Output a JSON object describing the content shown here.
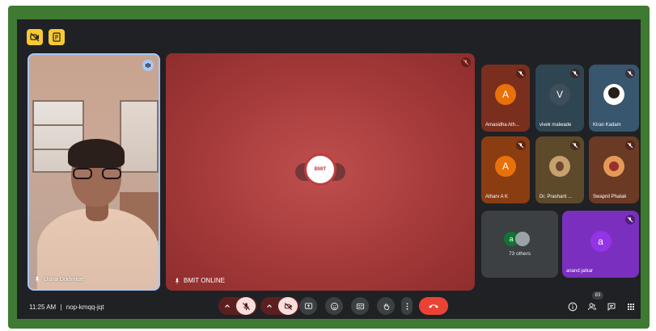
{
  "meeting": {
    "time": "11:25 AM",
    "separator": "|",
    "code": "nop-kmqq-jqt",
    "participant_count": "83"
  },
  "speaker": {
    "name": "Usha Dodmise"
  },
  "presenter": {
    "name": "BMIT ONLINE",
    "logo_text": "BMIT"
  },
  "participants": [
    {
      "name": "Amasidha Ath...",
      "initial": "A",
      "color": "#e8710a",
      "bg": "#7a2f1e",
      "muted": true
    },
    {
      "name": "vivek malwade",
      "initial": "V",
      "color": "#3c4f5a",
      "bg": "#2f4652",
      "muted": true
    },
    {
      "name": "Kiran Kadam",
      "initial": "",
      "color": "#ffffff",
      "bg": "#38566d",
      "muted": true
    },
    {
      "name": "Atharv A K",
      "initial": "A",
      "color": "#e8710a",
      "bg": "#8b3d12",
      "muted": true
    },
    {
      "name": "Dr. Prashant ...",
      "initial": "",
      "color": "#c8a06e",
      "bg": "#5c4a2a",
      "muted": true
    },
    {
      "name": "Swapnil Phatak",
      "initial": "",
      "color": "#e49a55",
      "bg": "#6a3a24",
      "muted": true
    }
  ],
  "others": {
    "label": "73 others",
    "initial": "a"
  },
  "last_tile": {
    "name": "anand jatkar",
    "initial": "a"
  }
}
